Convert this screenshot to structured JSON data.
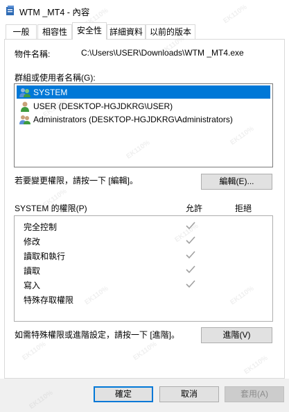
{
  "window": {
    "title": "WTM _MT4 - 內容",
    "icon": "file-icon"
  },
  "tabs": [
    {
      "label": "一般",
      "active": false
    },
    {
      "label": "相容性",
      "active": false
    },
    {
      "label": "安全性",
      "active": true
    },
    {
      "label": "詳細資料",
      "active": false
    },
    {
      "label": "以前的版本",
      "active": false
    }
  ],
  "security": {
    "object_name_label": "物件名稱:",
    "object_name_value": "C:\\Users\\USER\\Downloads\\WTM _MT4.exe",
    "groups_label": "群組或使用者名稱(G):",
    "users": [
      {
        "name": "SYSTEM",
        "icon": "group-users-icon",
        "selected": true
      },
      {
        "name": "USER (DESKTOP-HGJDKRG\\USER)",
        "icon": "user-icon",
        "selected": false
      },
      {
        "name": "Administrators (DESKTOP-HGJDKRG\\Administrators)",
        "icon": "group-users-icon",
        "selected": false
      }
    ],
    "edit_hint": "若要變更權限，請按一下 [編輯]。",
    "edit_button": "編輯(E)...",
    "permissions_label": "SYSTEM 的權限(P)",
    "allow_header": "允許",
    "deny_header": "拒絕",
    "permissions": [
      {
        "name": "完全控制",
        "allow": true,
        "deny": false
      },
      {
        "name": "修改",
        "allow": true,
        "deny": false
      },
      {
        "name": "讀取和執行",
        "allow": true,
        "deny": false
      },
      {
        "name": "讀取",
        "allow": true,
        "deny": false
      },
      {
        "name": "寫入",
        "allow": true,
        "deny": false
      },
      {
        "name": "特殊存取權限",
        "allow": false,
        "deny": false
      }
    ],
    "advanced_hint": "如需特殊權限或進階設定，請按一下 [進階]。",
    "advanced_button": "進階(V)"
  },
  "footer": {
    "ok": "確定",
    "cancel": "取消",
    "apply": "套用(A)"
  },
  "colors": {
    "selection": "#0078d7",
    "check": "#a0a0a0"
  },
  "watermark": "EK110%"
}
